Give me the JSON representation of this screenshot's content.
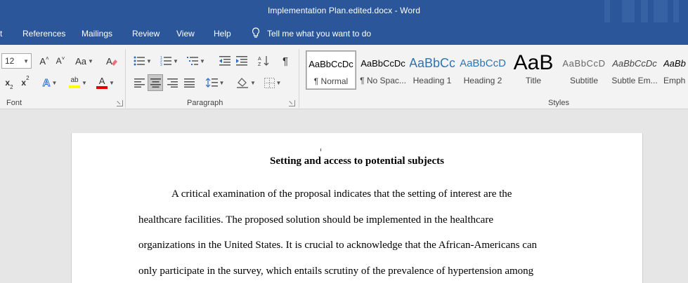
{
  "window": {
    "title": "Implementation Plan.edited.docx  -  Word"
  },
  "menu": {
    "tabs": [
      "t",
      "References",
      "Mailings",
      "Review",
      "View",
      "Help"
    ],
    "tell_me": "Tell me what you want to do"
  },
  "ribbon": {
    "font": {
      "size": "12",
      "group_label": "Font"
    },
    "paragraph": {
      "group_label": "Paragraph"
    },
    "styles": {
      "group_label": "Styles",
      "items": [
        {
          "sample": "AaBbCcDc",
          "name": "¶ Normal"
        },
        {
          "sample": "AaBbCcDc",
          "name": "¶ No Spac..."
        },
        {
          "sample": "AaBbCc",
          "name": "Heading 1"
        },
        {
          "sample": "AaBbCcD",
          "name": "Heading 2"
        },
        {
          "sample": "AaB",
          "name": "Title"
        },
        {
          "sample": "AaBbCcD",
          "name": "Subtitle"
        },
        {
          "sample": "AaBbCcDc",
          "name": "Subtle Em..."
        },
        {
          "sample": "AaBb",
          "name": "Emph"
        }
      ]
    }
  },
  "document": {
    "heading": "Setting and access to potential subjects",
    "lines": [
      "A critical examination of the proposal indicates that the setting of interest are the",
      "healthcare facilities. The proposed solution should be implemented in the healthcare",
      "organizations in the United States. It is crucial to acknowledge that the African-Americans can",
      "only participate in the survey, which entails scrutiny of the prevalence of hypertension among"
    ]
  },
  "icons": {
    "grow_font": "grow-font-icon",
    "shrink_font": "shrink-font-icon",
    "change_case": "change-case-icon",
    "clear_formatting": "clear-formatting-icon",
    "subscript": "subscript-icon",
    "superscript": "superscript-icon",
    "text_effects": "text-effects-icon",
    "highlight": "highlight-icon",
    "font_color": "font-color-icon",
    "bullets": "bullets-icon",
    "numbering": "numbering-icon",
    "multilevel": "multilevel-list-icon",
    "decrease_indent": "decrease-indent-icon",
    "increase_indent": "increase-indent-icon",
    "sort": "sort-icon",
    "show_marks": "pilcrow-icon",
    "shading": "shading-icon",
    "borders": "borders-icon"
  },
  "colors": {
    "title_bar": "#2b579a",
    "highlight": "#ffff00",
    "font_color": "#e00000",
    "text_effects": "#2b6cc4"
  }
}
